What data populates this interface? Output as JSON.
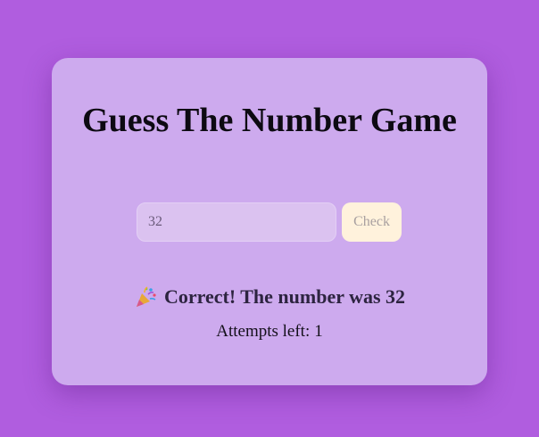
{
  "game": {
    "title": "Guess The Number Game",
    "guess_value": "32",
    "check_label": "Check",
    "result_message": "Correct! The number was 32",
    "result_icon": "party-popper-icon",
    "attempts_label": "Attempts left:",
    "attempts_left": "1"
  },
  "colors": {
    "background": "#b05ddf",
    "card": "#cdaaee",
    "button": "#fff2dc"
  }
}
